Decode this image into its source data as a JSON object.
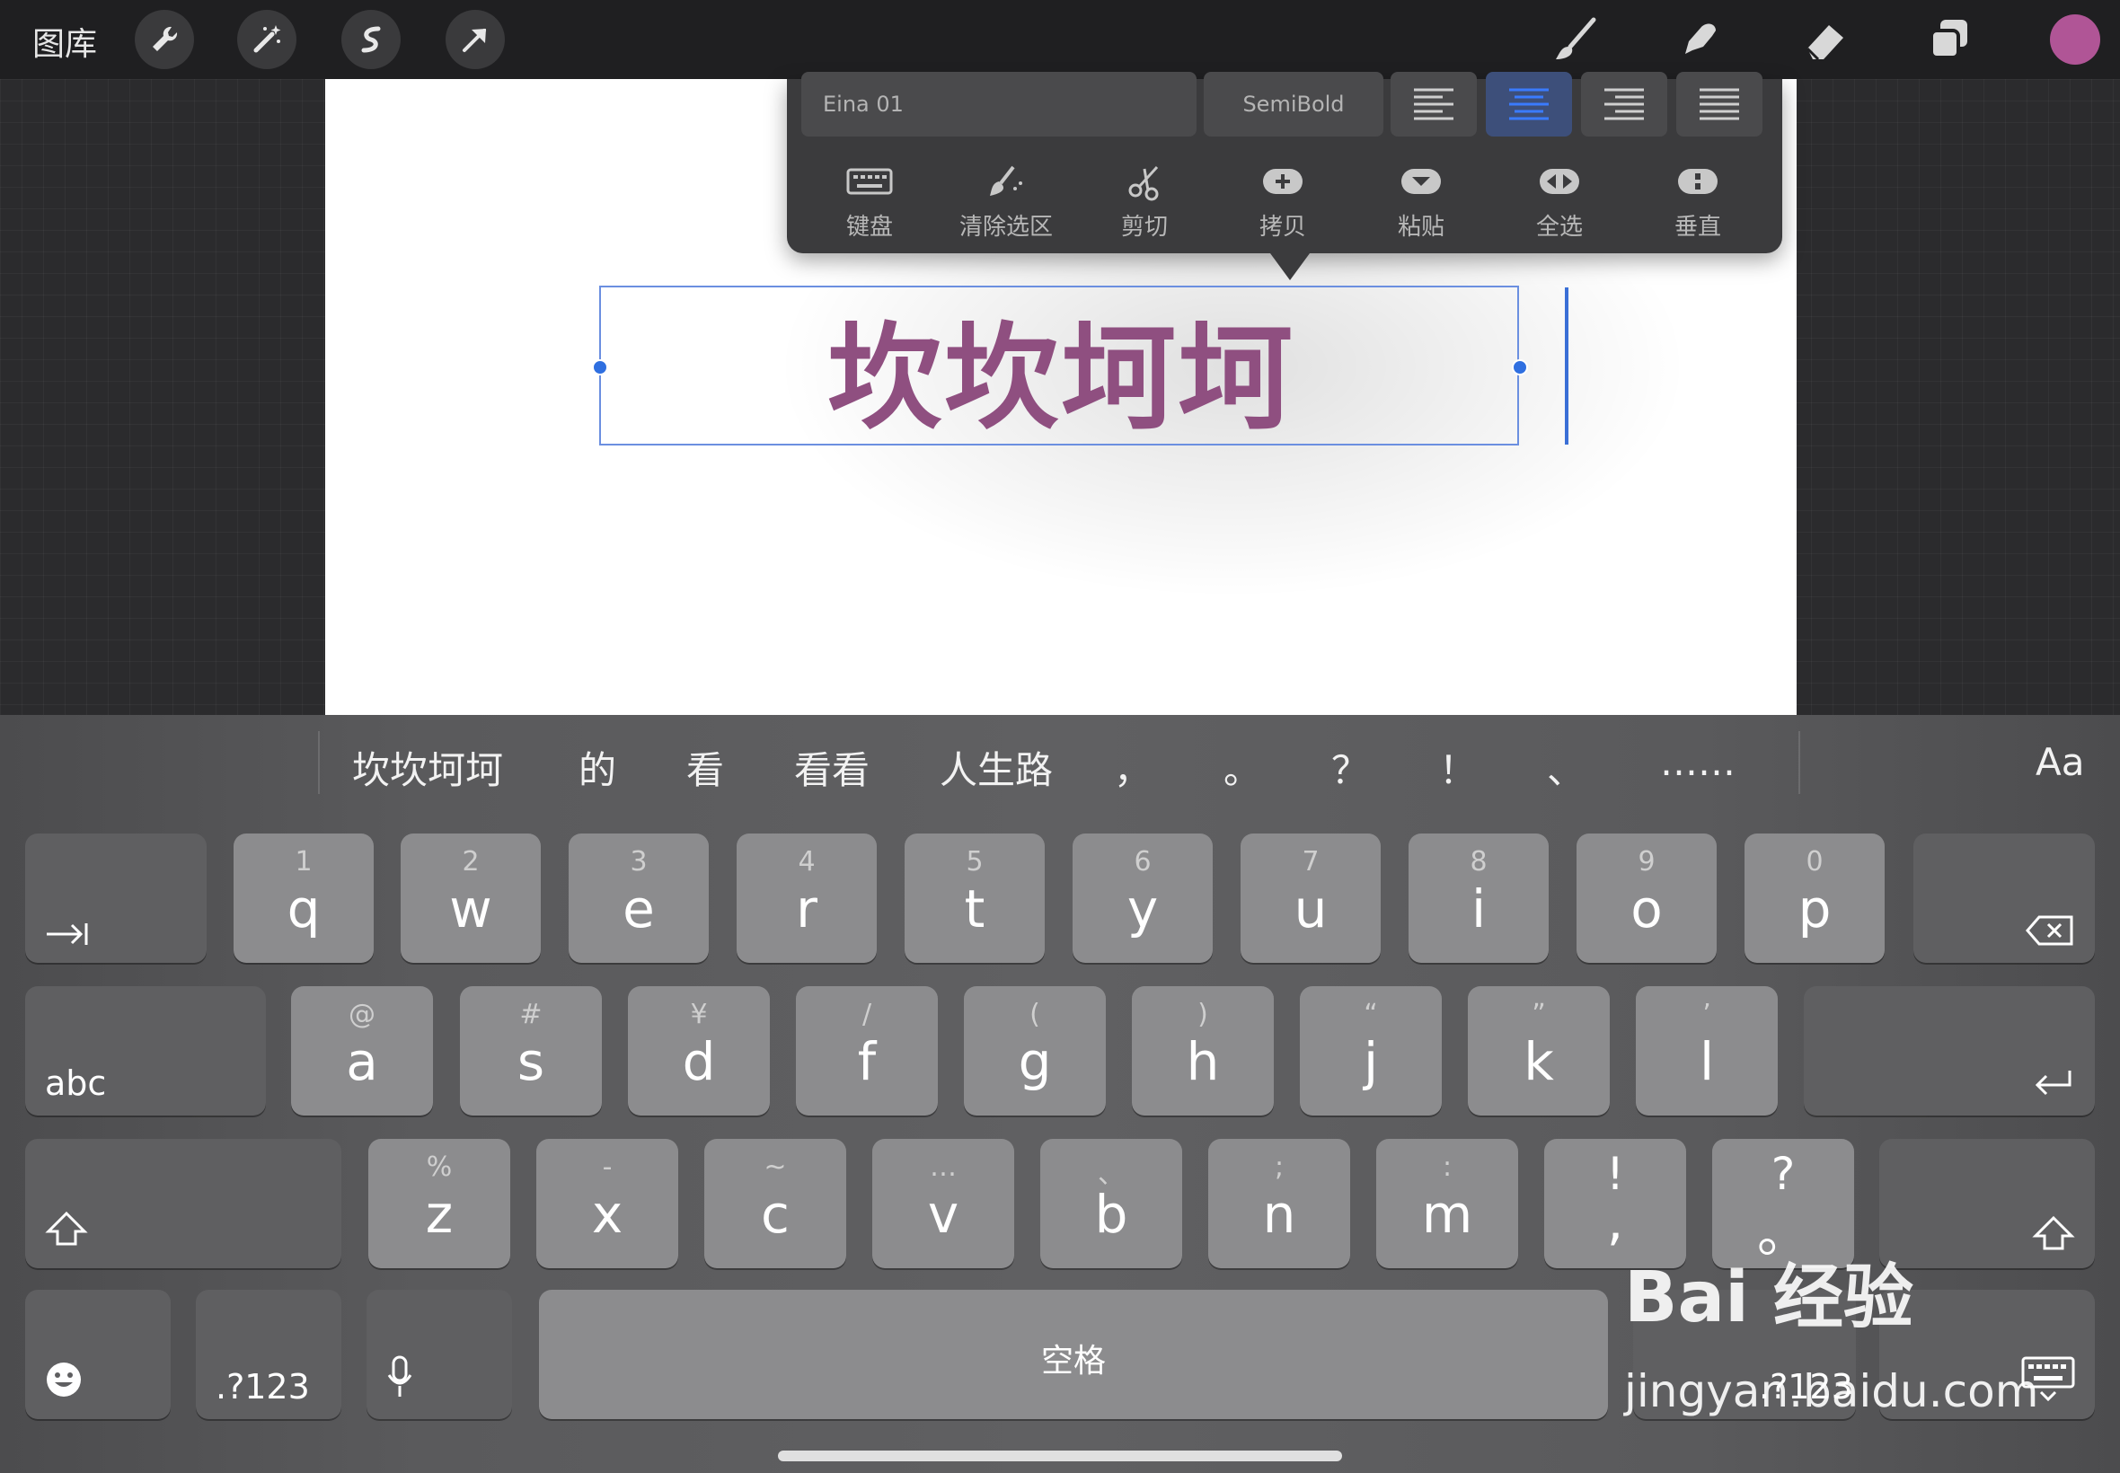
{
  "topbar": {
    "gallery_label": "图库",
    "tools_left": [
      "wrench-icon",
      "magic-wand-icon",
      "selection-icon",
      "transform-arrow-icon"
    ],
    "tools_right": [
      "brush-icon",
      "smudge-icon",
      "eraser-icon",
      "layers-icon"
    ],
    "active_color": "#b05596"
  },
  "popover": {
    "font_name": "Eina 01",
    "font_weight": "SemiBold",
    "alignments": [
      "align-left",
      "align-center",
      "align-right",
      "justify"
    ],
    "active_alignment": "align-center",
    "actions": [
      {
        "label": "键盘",
        "icon": "keyboard-icon"
      },
      {
        "label": "清除选区",
        "icon": "clear-selection-icon"
      },
      {
        "label": "剪切",
        "icon": "scissors-icon"
      },
      {
        "label": "拷贝",
        "icon": "copy-icon"
      },
      {
        "label": "粘贴",
        "icon": "paste-icon"
      },
      {
        "label": "全选",
        "icon": "select-all-icon"
      },
      {
        "label": "垂直",
        "icon": "vertical-icon"
      }
    ]
  },
  "canvas": {
    "text": "坎坎坷坷",
    "text_color": "#8f4f80"
  },
  "keyboard": {
    "suggestions": [
      "坎坎坷坷",
      "的",
      "看",
      "看看",
      "人生路",
      "，",
      "。",
      "？",
      "！",
      "、",
      "……"
    ],
    "case_toggle": "Aa",
    "row1": [
      {
        "hint": "1",
        "key": "q"
      },
      {
        "hint": "2",
        "key": "w"
      },
      {
        "hint": "3",
        "key": "e"
      },
      {
        "hint": "4",
        "key": "r"
      },
      {
        "hint": "5",
        "key": "t"
      },
      {
        "hint": "6",
        "key": "y"
      },
      {
        "hint": "7",
        "key": "u"
      },
      {
        "hint": "8",
        "key": "i"
      },
      {
        "hint": "9",
        "key": "o"
      },
      {
        "hint": "0",
        "key": "p"
      }
    ],
    "row2": [
      {
        "hint": "@",
        "key": "a"
      },
      {
        "hint": "#",
        "key": "s"
      },
      {
        "hint": "¥",
        "key": "d"
      },
      {
        "hint": "/",
        "key": "f"
      },
      {
        "hint": "(",
        "key": "g"
      },
      {
        "hint": ")",
        "key": "h"
      },
      {
        "hint": "“",
        "key": "j"
      },
      {
        "hint": "”",
        "key": "k"
      },
      {
        "hint": "’",
        "key": "l"
      }
    ],
    "row3": [
      {
        "hint": "%",
        "key": "z"
      },
      {
        "hint": "-",
        "key": "x"
      },
      {
        "hint": "~",
        "key": "c"
      },
      {
        "hint": "…",
        "key": "v"
      },
      {
        "hint": "、",
        "key": "b"
      },
      {
        "hint": ";",
        "key": "n"
      },
      {
        "hint": ":",
        "key": "m"
      },
      {
        "hint": "!",
        "key": ","
      },
      {
        "hint": "?",
        "key": "。"
      }
    ],
    "abc_label": "abc",
    "num_label_left": ".?123",
    "num_label_right": ".?123",
    "space_label": "空格"
  },
  "watermark": {
    "main": "Bai 经验",
    "sub": "jingyan.baidu.com"
  }
}
